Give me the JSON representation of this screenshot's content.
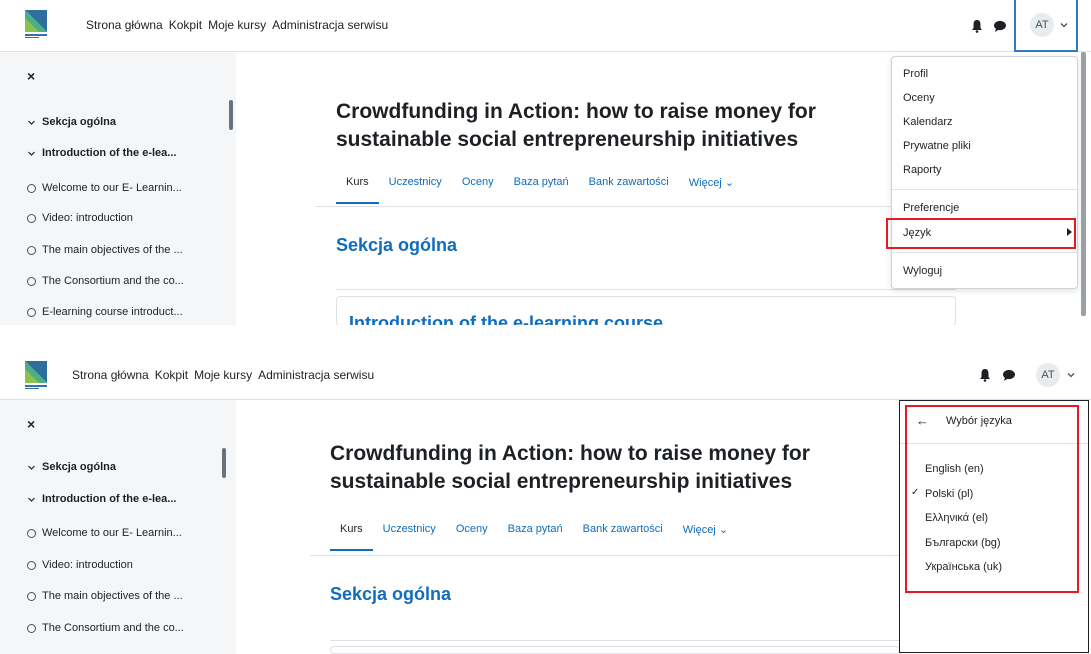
{
  "nav": {
    "links": [
      "Strona główna",
      "Kokpit",
      "Moje kursy",
      "Administracja serwisu"
    ],
    "avatar_initials": "AT"
  },
  "drawer": {
    "close_glyph": "×",
    "items": [
      {
        "label": "Sekcja ogólna",
        "kind": "section"
      },
      {
        "label": "Introduction of the e-lea...",
        "kind": "section"
      },
      {
        "label": "Welcome to our E- Learnin...",
        "kind": "activity"
      },
      {
        "label": "Video: introduction",
        "kind": "activity"
      },
      {
        "label": "The main objectives of the ...",
        "kind": "activity"
      },
      {
        "label": "The Consortium and the co...",
        "kind": "activity"
      },
      {
        "label": "E-learning course introduct...",
        "kind": "activity"
      }
    ]
  },
  "course": {
    "title": "Crowdfunding in Action: how to raise money for sustainable social entrepreneurship initiatives",
    "tabs": [
      "Kurs",
      "Uczestnicy",
      "Oceny",
      "Baza pytań",
      "Bank zawartości",
      "Więcej"
    ],
    "active_tab": "Kurs",
    "section_title": "Sekcja ogólna",
    "card_title": "Introduction of the e-learning course"
  },
  "user_menu": {
    "items": [
      "Profil",
      "Oceny",
      "Kalendarz",
      "Prywatne pliki",
      "Raporty"
    ],
    "items2": [
      "Preferencje",
      "Język"
    ],
    "logout": "Wyloguj",
    "highlighted": "Język"
  },
  "language_menu": {
    "title": "Wybór języka",
    "languages": [
      "English (en)",
      "Polski (pl)",
      "Ελληνικά (el)",
      "Български (bg)",
      "Українська (uk)"
    ],
    "selected": "Polski (pl)"
  },
  "colors": {
    "link": "#0f6cbf",
    "highlight": "#e31b23",
    "focus": "#2e7bbf"
  }
}
